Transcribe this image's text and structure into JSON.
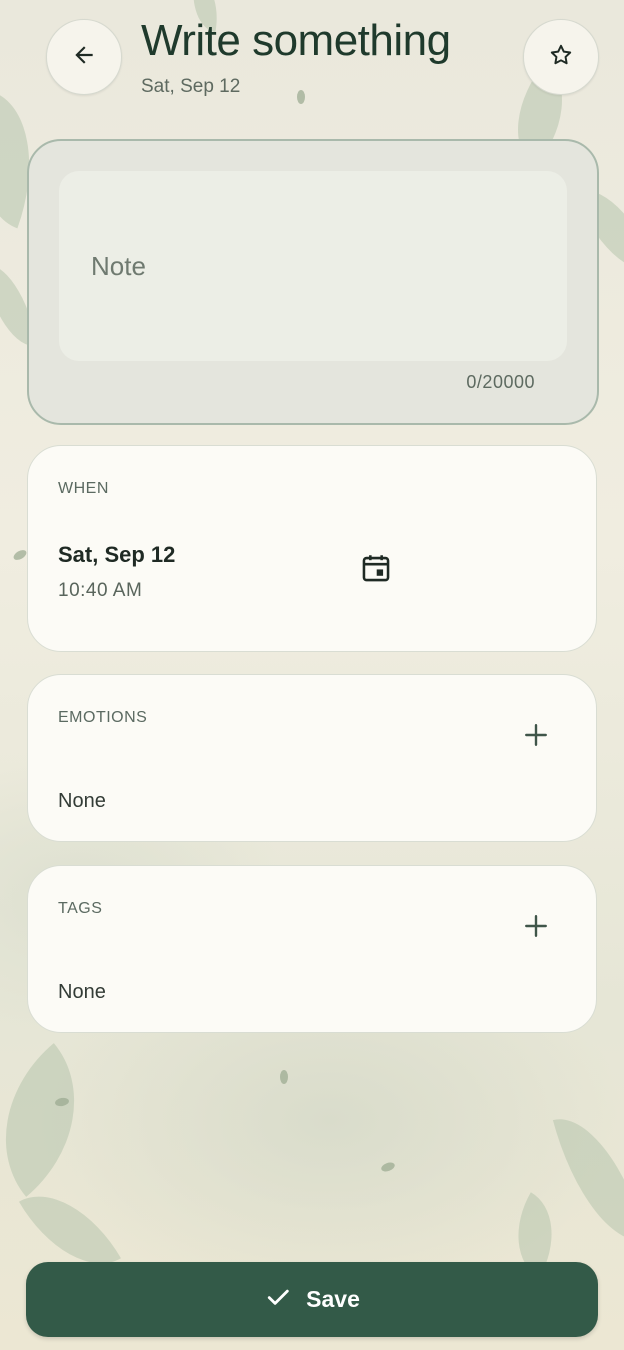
{
  "header": {
    "title": "Write something",
    "subtitle": "Sat, Sep 12",
    "back_icon": "arrow-back-icon",
    "favorite_icon": "star-outline-icon"
  },
  "note": {
    "placeholder": "Note",
    "value": "",
    "counter": "0/20000"
  },
  "when": {
    "label": "WHEN",
    "date": "Sat, Sep 12",
    "time": "10:40 AM",
    "icon": "calendar-icon"
  },
  "emotions": {
    "label": "EMOTIONS",
    "value": "None",
    "icon": "plus-icon"
  },
  "tags": {
    "label": "TAGS",
    "value": "None",
    "icon": "plus-icon"
  },
  "save": {
    "label": "Save",
    "icon": "check-icon"
  },
  "colors": {
    "primary": "#335a48",
    "title": "#1f3a2c",
    "card": "#fcfbf6",
    "note_card": "#e4e5dd"
  }
}
